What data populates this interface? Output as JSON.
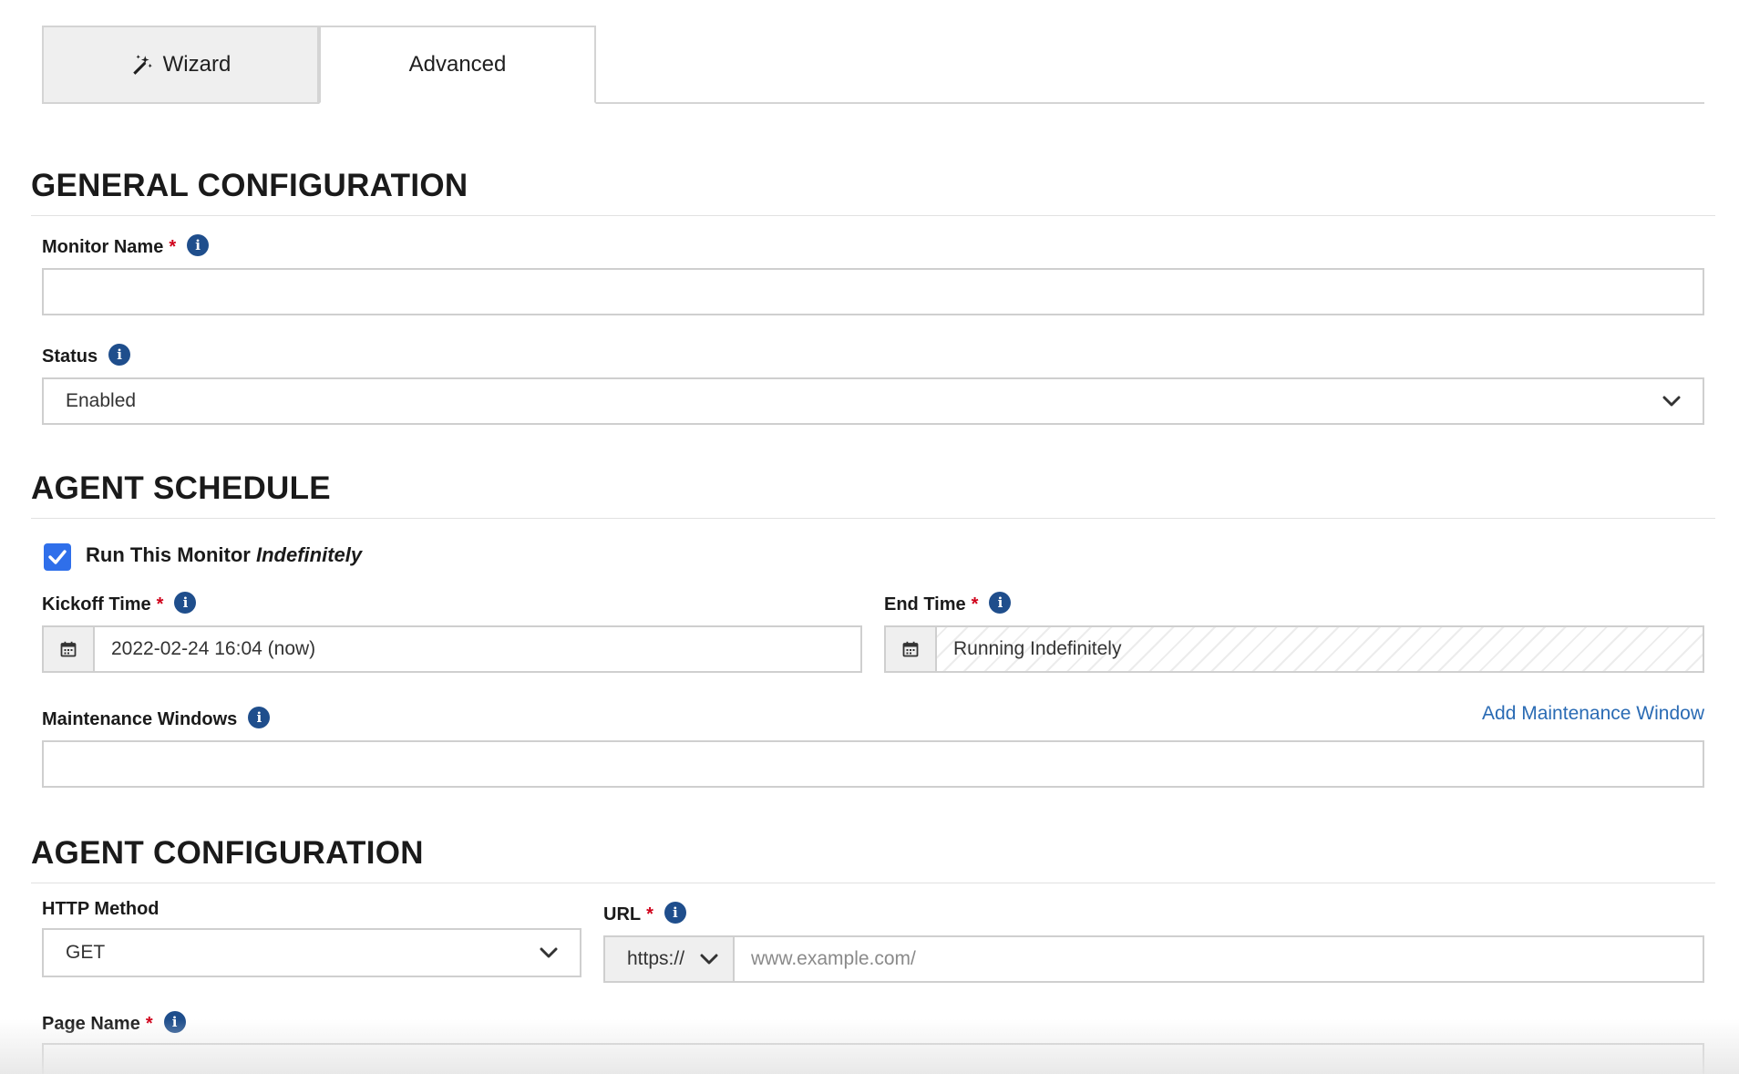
{
  "tabs": {
    "wizard_label": "Wizard",
    "advanced_label": "Advanced",
    "active": "Advanced"
  },
  "general": {
    "title": "GENERAL CONFIGURATION",
    "monitor_name_label": "Monitor Name",
    "monitor_name_value": "",
    "status_label": "Status",
    "status_value": "Enabled"
  },
  "schedule": {
    "title": "AGENT SCHEDULE",
    "run_indefinitely_prefix": "Run This Monitor",
    "run_indefinitely_emphasis": "Indefinitely",
    "run_indefinitely_checked": true,
    "kickoff_label": "Kickoff Time",
    "kickoff_value": "2022-02-24 16:04 (now)",
    "end_label": "End Time",
    "end_value": "Running Indefinitely",
    "maintenance_label": "Maintenance Windows",
    "add_maintenance_link": "Add Maintenance Window"
  },
  "agent": {
    "title": "AGENT CONFIGURATION",
    "http_method_label": "HTTP Method",
    "http_method_value": "GET",
    "url_label": "URL",
    "url_protocol": "https://",
    "url_placeholder": "www.example.com/",
    "page_name_label": "Page Name"
  },
  "common": {
    "required_mark": "*",
    "info_glyph": "i"
  },
  "colors": {
    "accent": "#2f6fea",
    "link": "#2a6bb4",
    "info_icon": "#1f4e8c",
    "required": "#d0021b"
  }
}
